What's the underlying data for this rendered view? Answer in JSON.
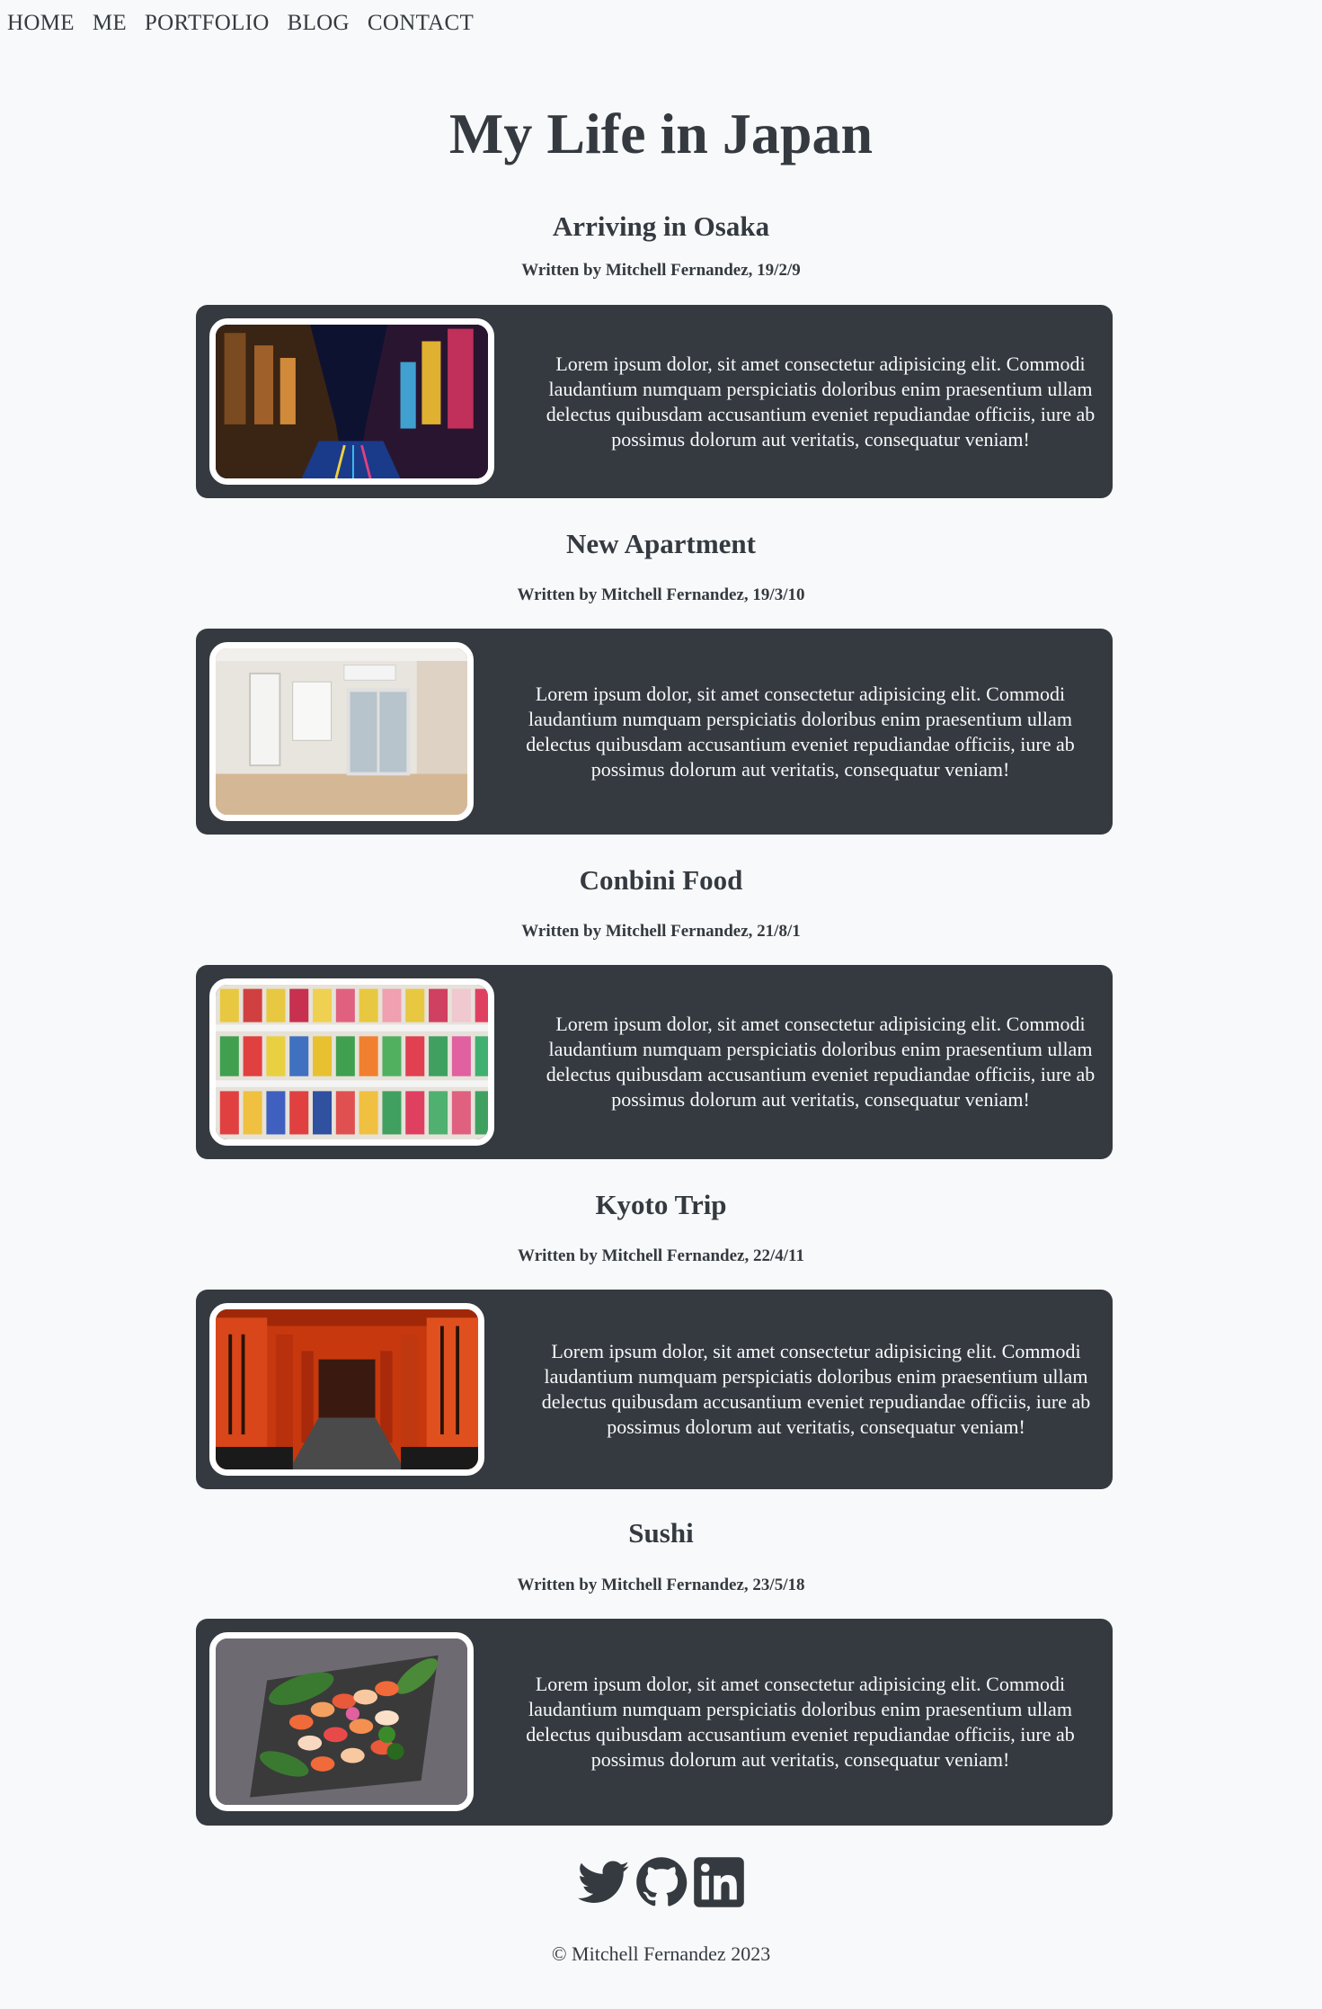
{
  "nav": {
    "items": [
      "HOME",
      "ME",
      "PORTFOLIO",
      "BLOG",
      "CONTACT"
    ]
  },
  "page_title": "My Life in Japan",
  "posts": [
    {
      "title": "Arriving in Osaka",
      "meta": "Written by Mitchell Fernandez, 19/2/9",
      "text": "Lorem ipsum dolor, sit amet consectetur adipisicing elit. Commodi laudantium numquam perspiciatis doloribus enim praesentium ullam delectus quibusdam accusantium eveniet repudiandae officiis, iure ab possimus dolorum aut veritatis, consequatur veniam!"
    },
    {
      "title": "New Apartment",
      "meta": "Written by Mitchell Fernandez, 19/3/10",
      "text": "Lorem ipsum dolor, sit amet consectetur adipisicing elit. Commodi laudantium numquam perspiciatis doloribus enim praesentium ullam delectus quibusdam accusantium eveniet repudiandae officiis, iure ab possimus dolorum aut veritatis, consequatur veniam!"
    },
    {
      "title": "Conbini Food",
      "meta": "Written by Mitchell Fernandez, 21/8/1",
      "text": "Lorem ipsum dolor, sit amet consectetur adipisicing elit. Commodi laudantium numquam perspiciatis doloribus enim praesentium ullam delectus quibusdam accusantium eveniet repudiandae officiis, iure ab possimus dolorum aut veritatis, consequatur veniam!"
    },
    {
      "title": "Kyoto Trip",
      "meta": "Written by Mitchell Fernandez, 22/4/11",
      "text": "Lorem ipsum dolor, sit amet consectetur adipisicing elit. Commodi laudantium numquam perspiciatis doloribus enim praesentium ullam delectus quibusdam accusantium eveniet repudiandae officiis, iure ab possimus dolorum aut veritatis, consequatur veniam!"
    },
    {
      "title": "Sushi",
      "meta": "Written by Mitchell Fernandez, 23/5/18",
      "text": "Lorem ipsum dolor, sit amet consectetur adipisicing elit. Commodi laudantium numquam perspiciatis doloribus enim praesentium ullam delectus quibusdam accusantium eveniet repudiandae officiis, iure ab possimus dolorum aut veritatis, consequatur veniam!"
    }
  ],
  "social": {
    "icons": [
      "twitter-icon",
      "github-icon",
      "linkedin-icon"
    ]
  },
  "footer": {
    "copyright": "© Mitchell Fernandez 2023"
  },
  "colors": {
    "background": "#f8f9fa",
    "text": "#343a40",
    "card": "#343a40",
    "card_text": "#f8f9fa"
  }
}
